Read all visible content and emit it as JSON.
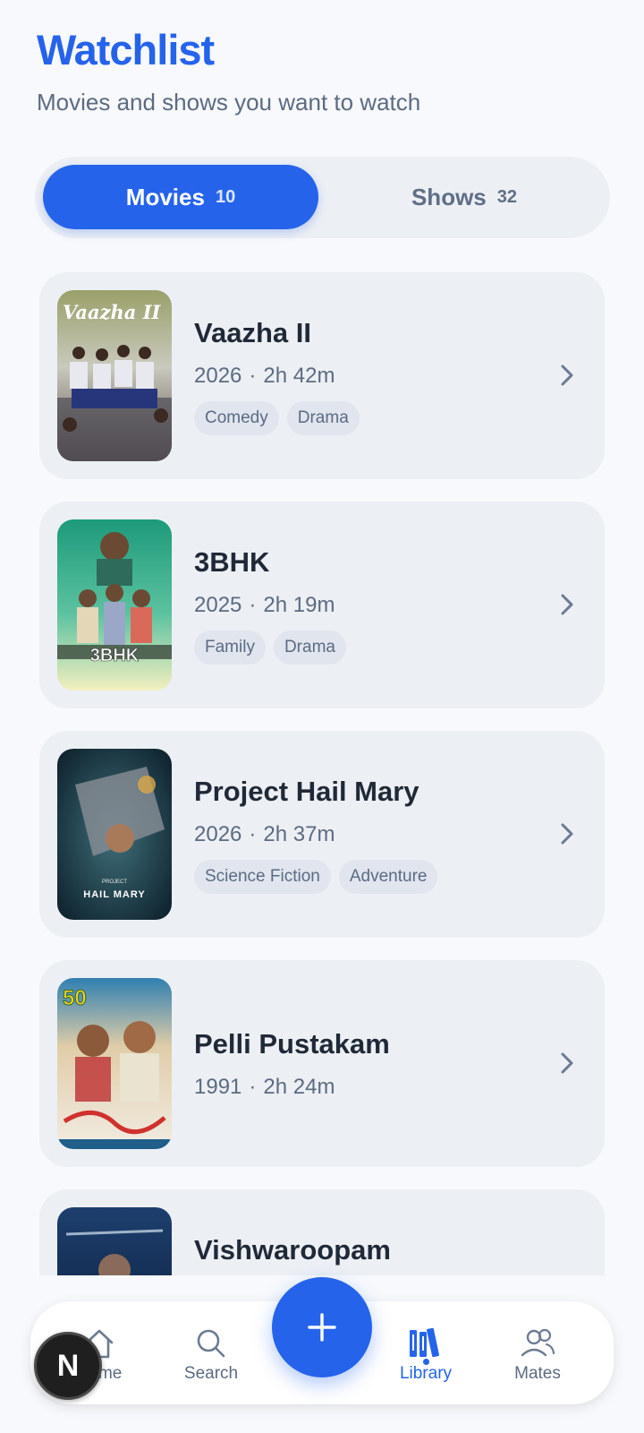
{
  "header": {
    "title": "Watchlist",
    "subtitle": "Movies and shows you want to watch"
  },
  "tabs": [
    {
      "label": "Movies",
      "count": "10",
      "active": true
    },
    {
      "label": "Shows",
      "count": "32",
      "active": false
    }
  ],
  "movies": [
    {
      "title": "Vaazha II",
      "year": "2026",
      "dot": "·",
      "duration": "2h 42m",
      "genres": [
        "Comedy",
        "Drama"
      ],
      "poster_text": "Vaazha II"
    },
    {
      "title": "3BHK",
      "year": "2025",
      "dot": "·",
      "duration": "2h 19m",
      "genres": [
        "Family",
        "Drama"
      ],
      "poster_text": "3BHK"
    },
    {
      "title": "Project Hail Mary",
      "year": "2026",
      "dot": "·",
      "duration": "2h 37m",
      "genres": [
        "Science Fiction",
        "Adventure"
      ],
      "poster_text": "HAIL MARY"
    },
    {
      "title": "Pelli Pustakam",
      "year": "1991",
      "dot": "·",
      "duration": "2h 24m",
      "genres": [],
      "poster_text": "50"
    },
    {
      "title": "Vishwaroopam",
      "year": "",
      "dot": "",
      "duration": "",
      "genres": []
    }
  ],
  "nav": {
    "home": "Home",
    "search": "Search",
    "library": "Library",
    "mates": "Mates",
    "active": "Library"
  },
  "avatar": {
    "initial": "N"
  },
  "colors": {
    "accent": "#2563eb",
    "background": "#f7f9fc",
    "card": "#eceff4",
    "muted_text": "#5b6b82"
  }
}
